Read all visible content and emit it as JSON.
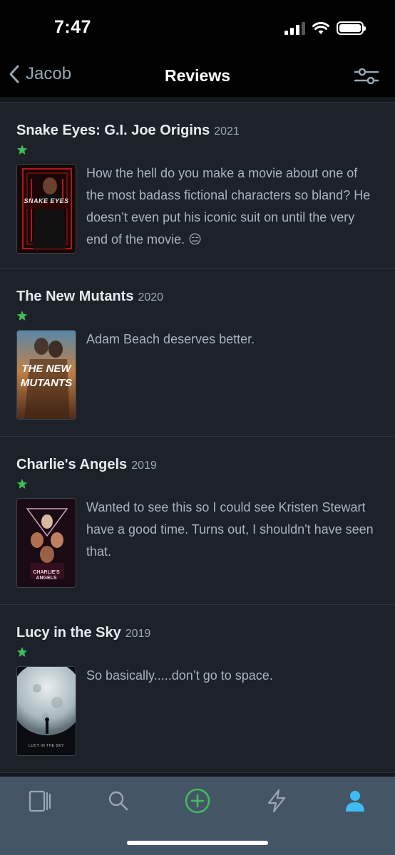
{
  "status_bar": {
    "time": "7:47"
  },
  "nav": {
    "back_label": "Jacob",
    "title": "Reviews"
  },
  "reviews": [
    {
      "title": "Snake Eyes: G.I. Joe Origins",
      "year": "2021",
      "rating_stars": 0.5,
      "text": "How the hell do you make a movie about one of the most badass fictional characters so bland? He doesn’t even put his iconic suit on until the very end of the movie. 😑",
      "poster_text": "SNAKE EYES"
    },
    {
      "title": "The New Mutants",
      "year": "2020",
      "rating_stars": 0.5,
      "text": "Adam Beach deserves better.",
      "poster_text": "THE NEW MUTANTS"
    },
    {
      "title": "Charlie's Angels",
      "year": "2019",
      "rating_stars": 0.5,
      "text": "Wanted to see this so I could see Kristen Stewart have a good time. Turns out, I shouldn't have seen that.",
      "poster_text": "CHARLIE'S ANGELS"
    },
    {
      "title": "Lucy in the Sky",
      "year": "2019",
      "rating_stars": 0.5,
      "text": "So basically.....don’t go to space.",
      "poster_text": "LUCY IN THE SKY"
    }
  ],
  "tab_bar": {
    "tabs": [
      {
        "icon": "films-icon"
      },
      {
        "icon": "search-icon"
      },
      {
        "icon": "add-icon"
      },
      {
        "icon": "activity-icon"
      },
      {
        "icon": "profile-icon"
      }
    ]
  },
  "colors": {
    "background": "#14181c",
    "row": "#1c2228",
    "star": "#40bc5c",
    "accent_blue": "#40bcf4",
    "tab_bar": "#445566"
  }
}
